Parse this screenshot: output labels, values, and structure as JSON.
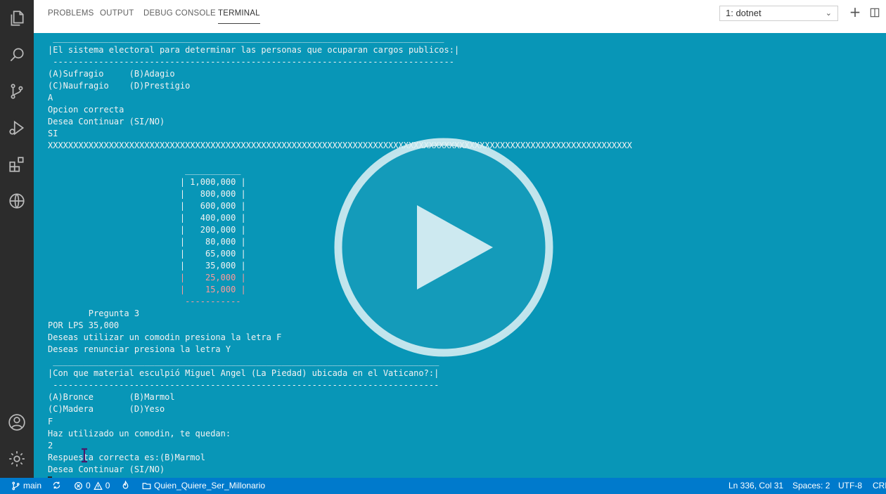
{
  "activity_bar": {
    "icons": [
      "explorer-icon",
      "search-icon",
      "source-control-icon",
      "run-debug-icon",
      "extensions-icon",
      "remote-explorer-icon",
      "account-icon",
      "settings-gear-icon"
    ]
  },
  "panel": {
    "tabs": [
      "PROBLEMS",
      "OUTPUT",
      "DEBUG CONSOLE",
      "TERMINAL"
    ],
    "active_tab": "TERMINAL",
    "terminal_select": "1: dotnet",
    "actions": [
      "new-terminal-icon",
      "split-terminal-icon"
    ]
  },
  "terminal": {
    "lines": [
      " _____________________________________________________________________________",
      "|El sistema electoral para determinar las personas que ocuparan cargos publicos:|",
      " -------------------------------------------------------------------------------",
      "(A)Sufragio     (B)Adagio",
      "(C)Naufragio    (D)Prestigio",
      "A",
      "Opcion correcta",
      "Desea Continuar (SI/NO)",
      "SI",
      "XXXXXXXXXXXXXXXXXXXXXXXXXXXXXXXXXXXXXXXXXXXXXXXXXXXXXXXXXXXXXXXXXXXXXXXXXXXXXXXXXXXXXXXXXXXXXXXXXXXXXXXXXXXXXXXXXXX",
      "",
      "                           ___________",
      "                          | 1,000,000 |",
      "                          |   800,000 |",
      "                          |   600,000 |",
      "                          |   400,000 |",
      "                          |   200,000 |",
      "                          |    80,000 |",
      "                          |    65,000 |",
      "                          |    35,000 |",
      "                          |    25,000 |",
      "                          |    15,000 |",
      "                           -----------",
      "        Pregunta 3",
      "POR LPS 35,000",
      "Deseas utilizar un comodin presiona la letra F",
      "Deseas renunciar presiona la letra Y",
      " ____________________________________________________________________________",
      "|Con que material esculpió Miguel Angel (La Piedad) ubicada en el Vaticano?:|",
      " ----------------------------------------------------------------------------",
      "(A)Bronce       (B)Marmol",
      "(C)Madera       (D)Yeso",
      "F",
      "Haz utilizado un comodin, te quedan:",
      "2",
      "Respuesta correcta es:(B)Marmol",
      "Desea Continuar (SI/NO)",
      ""
    ],
    "red_line_indexes": [
      20,
      21,
      22
    ],
    "colors": {
      "background": "#0896b7",
      "text": "#f2f2f2",
      "red": "#ff9a9a"
    }
  },
  "overlay": {
    "icon": "play-button-icon"
  },
  "status_bar": {
    "branch": "main",
    "errors": "0",
    "warnings": "0",
    "folder": "Quien_Quiere_Ser_Millonario",
    "position": "Ln 336, Col 31",
    "spaces": "Spaces: 2",
    "encoding": "UTF-8",
    "eol": "CRL",
    "color": "#007acc"
  }
}
